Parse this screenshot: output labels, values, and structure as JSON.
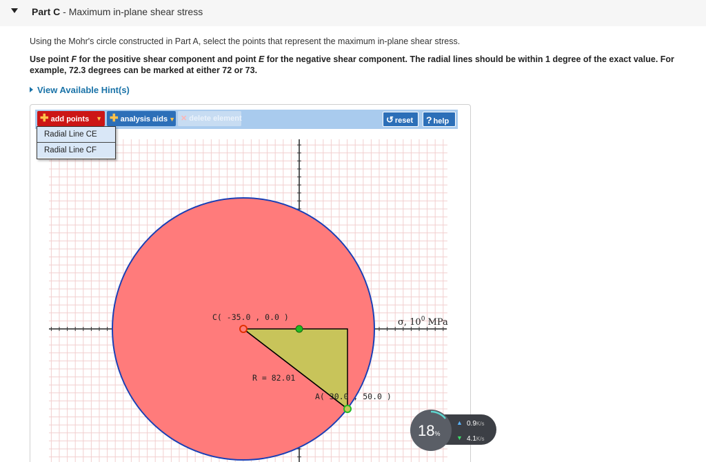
{
  "part": {
    "label": "Part C",
    "separator": " - ",
    "title": "Maximum in-plane shear stress"
  },
  "instructions": "Using the Mohr's circle constructed in Part A, select the points that represent the maximum in-plane shear stress.",
  "bold_instruction": {
    "p1": "Use point ",
    "f": "F",
    "p2": " for the positive shear component and point ",
    "e": "E",
    "p3": " for the negative shear component. The radial lines should be within 1 degree of the exact value. For example, 72.3 degrees can be marked at either 72 or 73."
  },
  "hint_link": "View Available Hint(s)",
  "toolbar": {
    "add_points": "add points",
    "analysis_aids": "analysis aids",
    "delete_element": "delete element",
    "reset": "reset",
    "help": "help"
  },
  "dropdown": {
    "items": [
      "Radial Line CE",
      "Radial Line CF"
    ]
  },
  "plot": {
    "circle_fill": "#ff7b7b",
    "circle_stroke": "#1a3fb5",
    "triangle_fill": "#c8c45a",
    "point_c_label": "C( -35.0 , 0.0 )",
    "point_a_label": "A( 30.0 , 50.0 )",
    "radius_label": "R = 82.01",
    "axis_label": "σ, 10",
    "axis_label_sup": "0",
    "axis_label_unit": " MPa"
  },
  "bandwidth": {
    "percent": "18",
    "percent_sign": "%",
    "up": "0.9",
    "down": "4.1",
    "unit": "K/s"
  }
}
